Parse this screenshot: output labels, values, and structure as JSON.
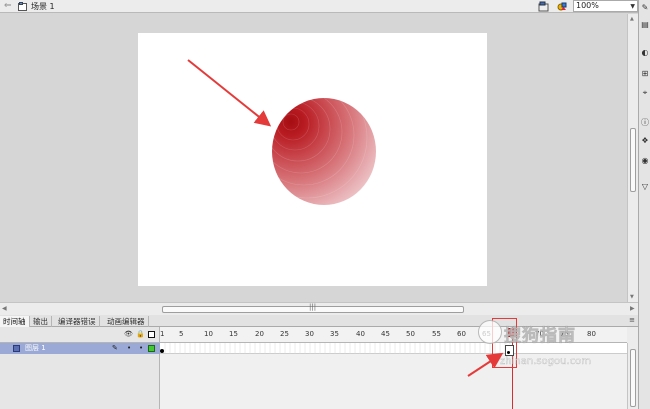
{
  "topbar": {
    "back_icon": "back-arrow-icon",
    "scene_label": "场景 1",
    "zoom": "100%"
  },
  "panel_tabs": [
    {
      "label": "时间轴",
      "active": true
    },
    {
      "label": "输出",
      "active": false
    },
    {
      "label": "编译器错误",
      "active": false
    },
    {
      "label": "动画编辑器",
      "active": false
    }
  ],
  "timeline": {
    "ruler": [
      "1",
      "5",
      "10",
      "15",
      "20",
      "25",
      "30",
      "35",
      "40",
      "45",
      "50",
      "55",
      "60",
      "65",
      "70",
      "75",
      "80"
    ],
    "layer_name": "图层 1",
    "layer_color": "#41c832"
  },
  "watermark": {
    "text": "搜狗指南",
    "url": "zhinan.sogou.com"
  },
  "colors": {
    "highlight": "#e53a3a",
    "stage": "#ffffff",
    "background": "#d6d6d6"
  }
}
